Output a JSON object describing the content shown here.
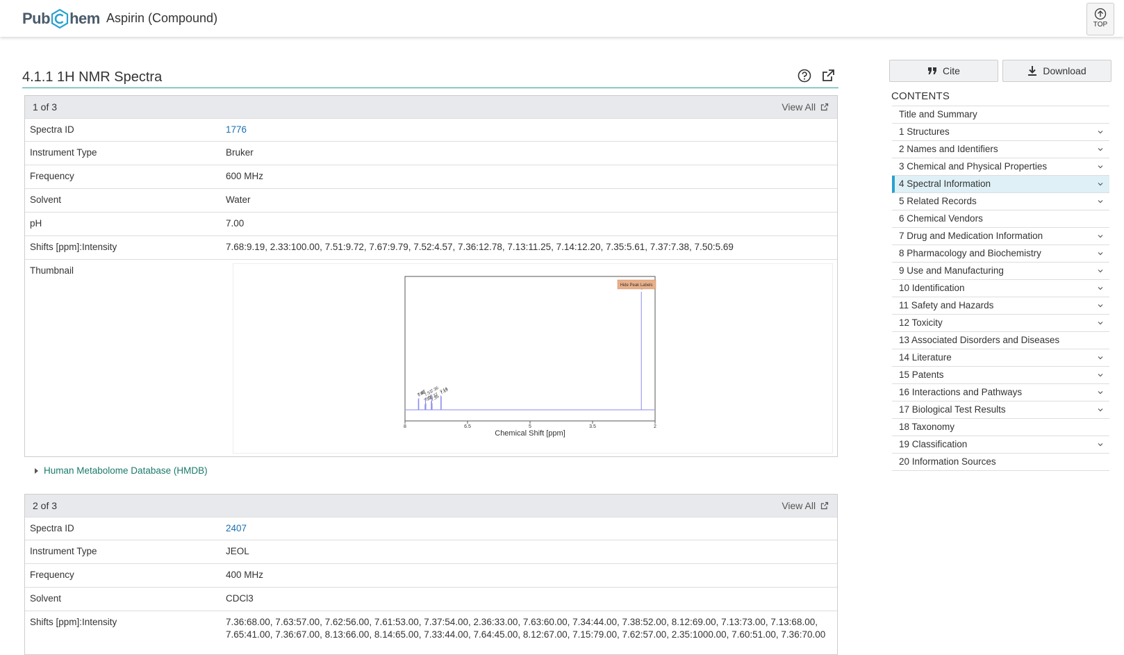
{
  "header": {
    "logo_left": "Pub",
    "logo_right": "hem",
    "title": "Aspirin (Compound)",
    "top_label": "TOP"
  },
  "section": {
    "title": "4.1.1 1H NMR Spectra"
  },
  "record1": {
    "count": "1 of 3",
    "view_all": "View All",
    "rows": [
      {
        "key": "Spectra ID",
        "value": "1776"
      },
      {
        "key": "Instrument Type",
        "value": "Bruker"
      },
      {
        "key": "Frequency",
        "value": "600 MHz"
      },
      {
        "key": "Solvent",
        "value": "Water"
      },
      {
        "key": "pH",
        "value": "7.00"
      },
      {
        "key": "Shifts [ppm]:Intensity",
        "value": "7.68:9.19, 2.33:100.00, 7.51:9.72, 7.67:9.79, 7.52:4.57, 7.36:12.78, 7.13:11.25, 7.14:12.20, 7.35:5.61, 7.37:7.38, 7.50:5.69"
      },
      {
        "key": "Thumbnail",
        "value": ""
      }
    ],
    "source": "Human Metabolome Database (HMDB)"
  },
  "chart_data": {
    "type": "line",
    "xlabel": "Chemical Shift [ppm]",
    "ylabel": "",
    "xlim": [
      8,
      2
    ],
    "xticks": [
      "8",
      "6.5",
      "5",
      "3.5",
      "2"
    ],
    "button": "Hide Peak Labels",
    "peaks": [
      {
        "x": 7.68,
        "y": 9.19
      },
      {
        "x": 7.67,
        "y": 9.79
      },
      {
        "x": 7.52,
        "y": 4.57
      },
      {
        "x": 7.51,
        "y": 9.72
      },
      {
        "x": 7.5,
        "y": 5.69
      },
      {
        "x": 7.37,
        "y": 7.38
      },
      {
        "x": 7.36,
        "y": 12.78
      },
      {
        "x": 7.35,
        "y": 5.61
      },
      {
        "x": 7.14,
        "y": 12.2
      },
      {
        "x": 7.13,
        "y": 11.25
      },
      {
        "x": 2.33,
        "y": 100.0
      }
    ],
    "peak_labels": [
      "7.68",
      "7.67",
      "7.52",
      "7.51",
      "7.50",
      "7.37",
      "7.36",
      "7.35",
      "7.14",
      "7.13",
      "2.33"
    ]
  },
  "record2": {
    "count": "2 of 3",
    "view_all": "View All",
    "rows": [
      {
        "key": "Spectra ID",
        "value": "2407"
      },
      {
        "key": "Instrument Type",
        "value": "JEOL"
      },
      {
        "key": "Frequency",
        "value": "400 MHz"
      },
      {
        "key": "Solvent",
        "value": "CDCl3"
      },
      {
        "key": "Shifts [ppm]:Intensity",
        "value": "7.36:68.00, 7.63:57.00, 7.62:56.00, 7.61:53.00, 7.37:54.00, 2.36:33.00, 7.63:60.00, 7.34:44.00, 7.38:52.00, 8.12:69.00, 7.13:73.00, 7.13:68.00,",
        "value2": "7.65:41.00, 7.36:67.00, 8.13:66.00, 8.14:65.00, 7.33:44.00, 7.64:45.00, 8.12:67.00, 7.15:79.00, 7.62:57.00, 2.35:1000.00, 7.60:51.00, 7.36:70.00"
      }
    ]
  },
  "sidebar": {
    "cite": "Cite",
    "download": "Download",
    "contents_title": "CONTENTS",
    "items": [
      {
        "label": "Title and Summary",
        "chevron": false,
        "active": false
      },
      {
        "label": "1 Structures",
        "chevron": true,
        "active": false
      },
      {
        "label": "2 Names and Identifiers",
        "chevron": true,
        "active": false
      },
      {
        "label": "3 Chemical and Physical Properties",
        "chevron": true,
        "active": false
      },
      {
        "label": "4 Spectral Information",
        "chevron": true,
        "active": true
      },
      {
        "label": "5 Related Records",
        "chevron": true,
        "active": false
      },
      {
        "label": "6 Chemical Vendors",
        "chevron": false,
        "active": false
      },
      {
        "label": "7 Drug and Medication Information",
        "chevron": true,
        "active": false
      },
      {
        "label": "8 Pharmacology and Biochemistry",
        "chevron": true,
        "active": false
      },
      {
        "label": "9 Use and Manufacturing",
        "chevron": true,
        "active": false
      },
      {
        "label": "10 Identification",
        "chevron": true,
        "active": false
      },
      {
        "label": "11 Safety and Hazards",
        "chevron": true,
        "active": false
      },
      {
        "label": "12 Toxicity",
        "chevron": true,
        "active": false
      },
      {
        "label": "13 Associated Disorders and Diseases",
        "chevron": false,
        "active": false
      },
      {
        "label": "14 Literature",
        "chevron": true,
        "active": false
      },
      {
        "label": "15 Patents",
        "chevron": true,
        "active": false
      },
      {
        "label": "16 Interactions and Pathways",
        "chevron": true,
        "active": false
      },
      {
        "label": "17 Biological Test Results",
        "chevron": true,
        "active": false
      },
      {
        "label": "18 Taxonomy",
        "chevron": false,
        "active": false
      },
      {
        "label": "19 Classification",
        "chevron": true,
        "active": false
      },
      {
        "label": "20 Information Sources",
        "chevron": false,
        "active": false
      }
    ]
  },
  "colors": {
    "accent": "#2a9d9d",
    "link": "#1a6fb0",
    "active_bg": "#dff0f6",
    "active_border": "#2aa1d0",
    "peak_button": "#e8b08a",
    "spectrum_line": "#8a8af0"
  }
}
